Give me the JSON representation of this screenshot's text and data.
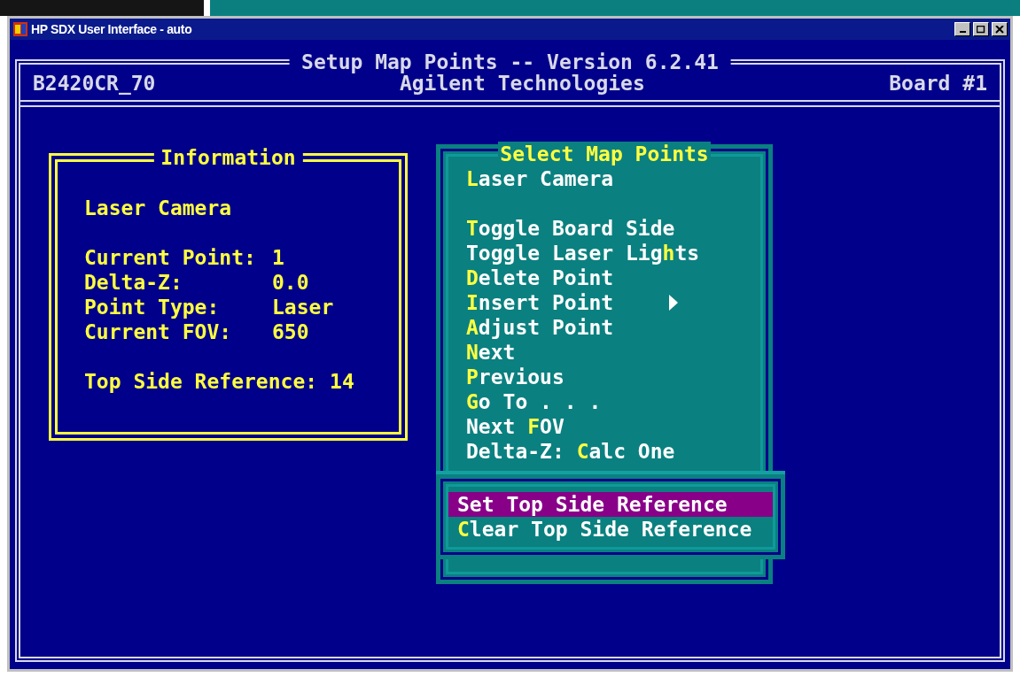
{
  "window": {
    "title": "HP SDX User Interface - auto"
  },
  "header": {
    "title": "Setup Map Points -- Version 6.2.41",
    "left": "B2420CR_70",
    "center": "Agilent Technologies",
    "right": "Board #1"
  },
  "information": {
    "title": "Information",
    "heading": "Laser Camera",
    "fields": [
      {
        "label": "Current Point:",
        "value": "1"
      },
      {
        "label": "Delta-Z:",
        "value": "0.0"
      },
      {
        "label": "Point Type:",
        "value": "Laser"
      },
      {
        "label": "Current FOV:",
        "value": "650"
      }
    ],
    "reference": {
      "label": "Top Side Reference:",
      "value": "14"
    }
  },
  "menu": {
    "title": "Select Map Points",
    "groups": [
      [
        {
          "label": "**L**aser Camera",
          "has_submenu": false
        }
      ],
      [
        {
          "label": "**T**oggle Board Side",
          "has_submenu": false
        },
        {
          "label": "Toggle Laser Lig**h**ts",
          "has_submenu": false
        },
        {
          "label": "**D**elete Point",
          "has_submenu": false
        },
        {
          "label": "**I**nsert Point",
          "has_submenu": true
        },
        {
          "label": "**A**djust Point",
          "has_submenu": false
        },
        {
          "label": "**N**ext",
          "has_submenu": false
        },
        {
          "label": "**P**revious",
          "has_submenu": false
        },
        {
          "label": "**G**o To . . .",
          "has_submenu": false
        },
        {
          "label": "Next **F**OV",
          "has_submenu": false
        },
        {
          "label": "Delta-Z: **C**alc One",
          "has_submenu": false
        }
      ]
    ]
  },
  "submenu": {
    "items": [
      {
        "label": "Set Top Side Reference",
        "selected": true
      },
      {
        "label": "**C**lear Top Side Reference",
        "selected": false
      }
    ]
  }
}
